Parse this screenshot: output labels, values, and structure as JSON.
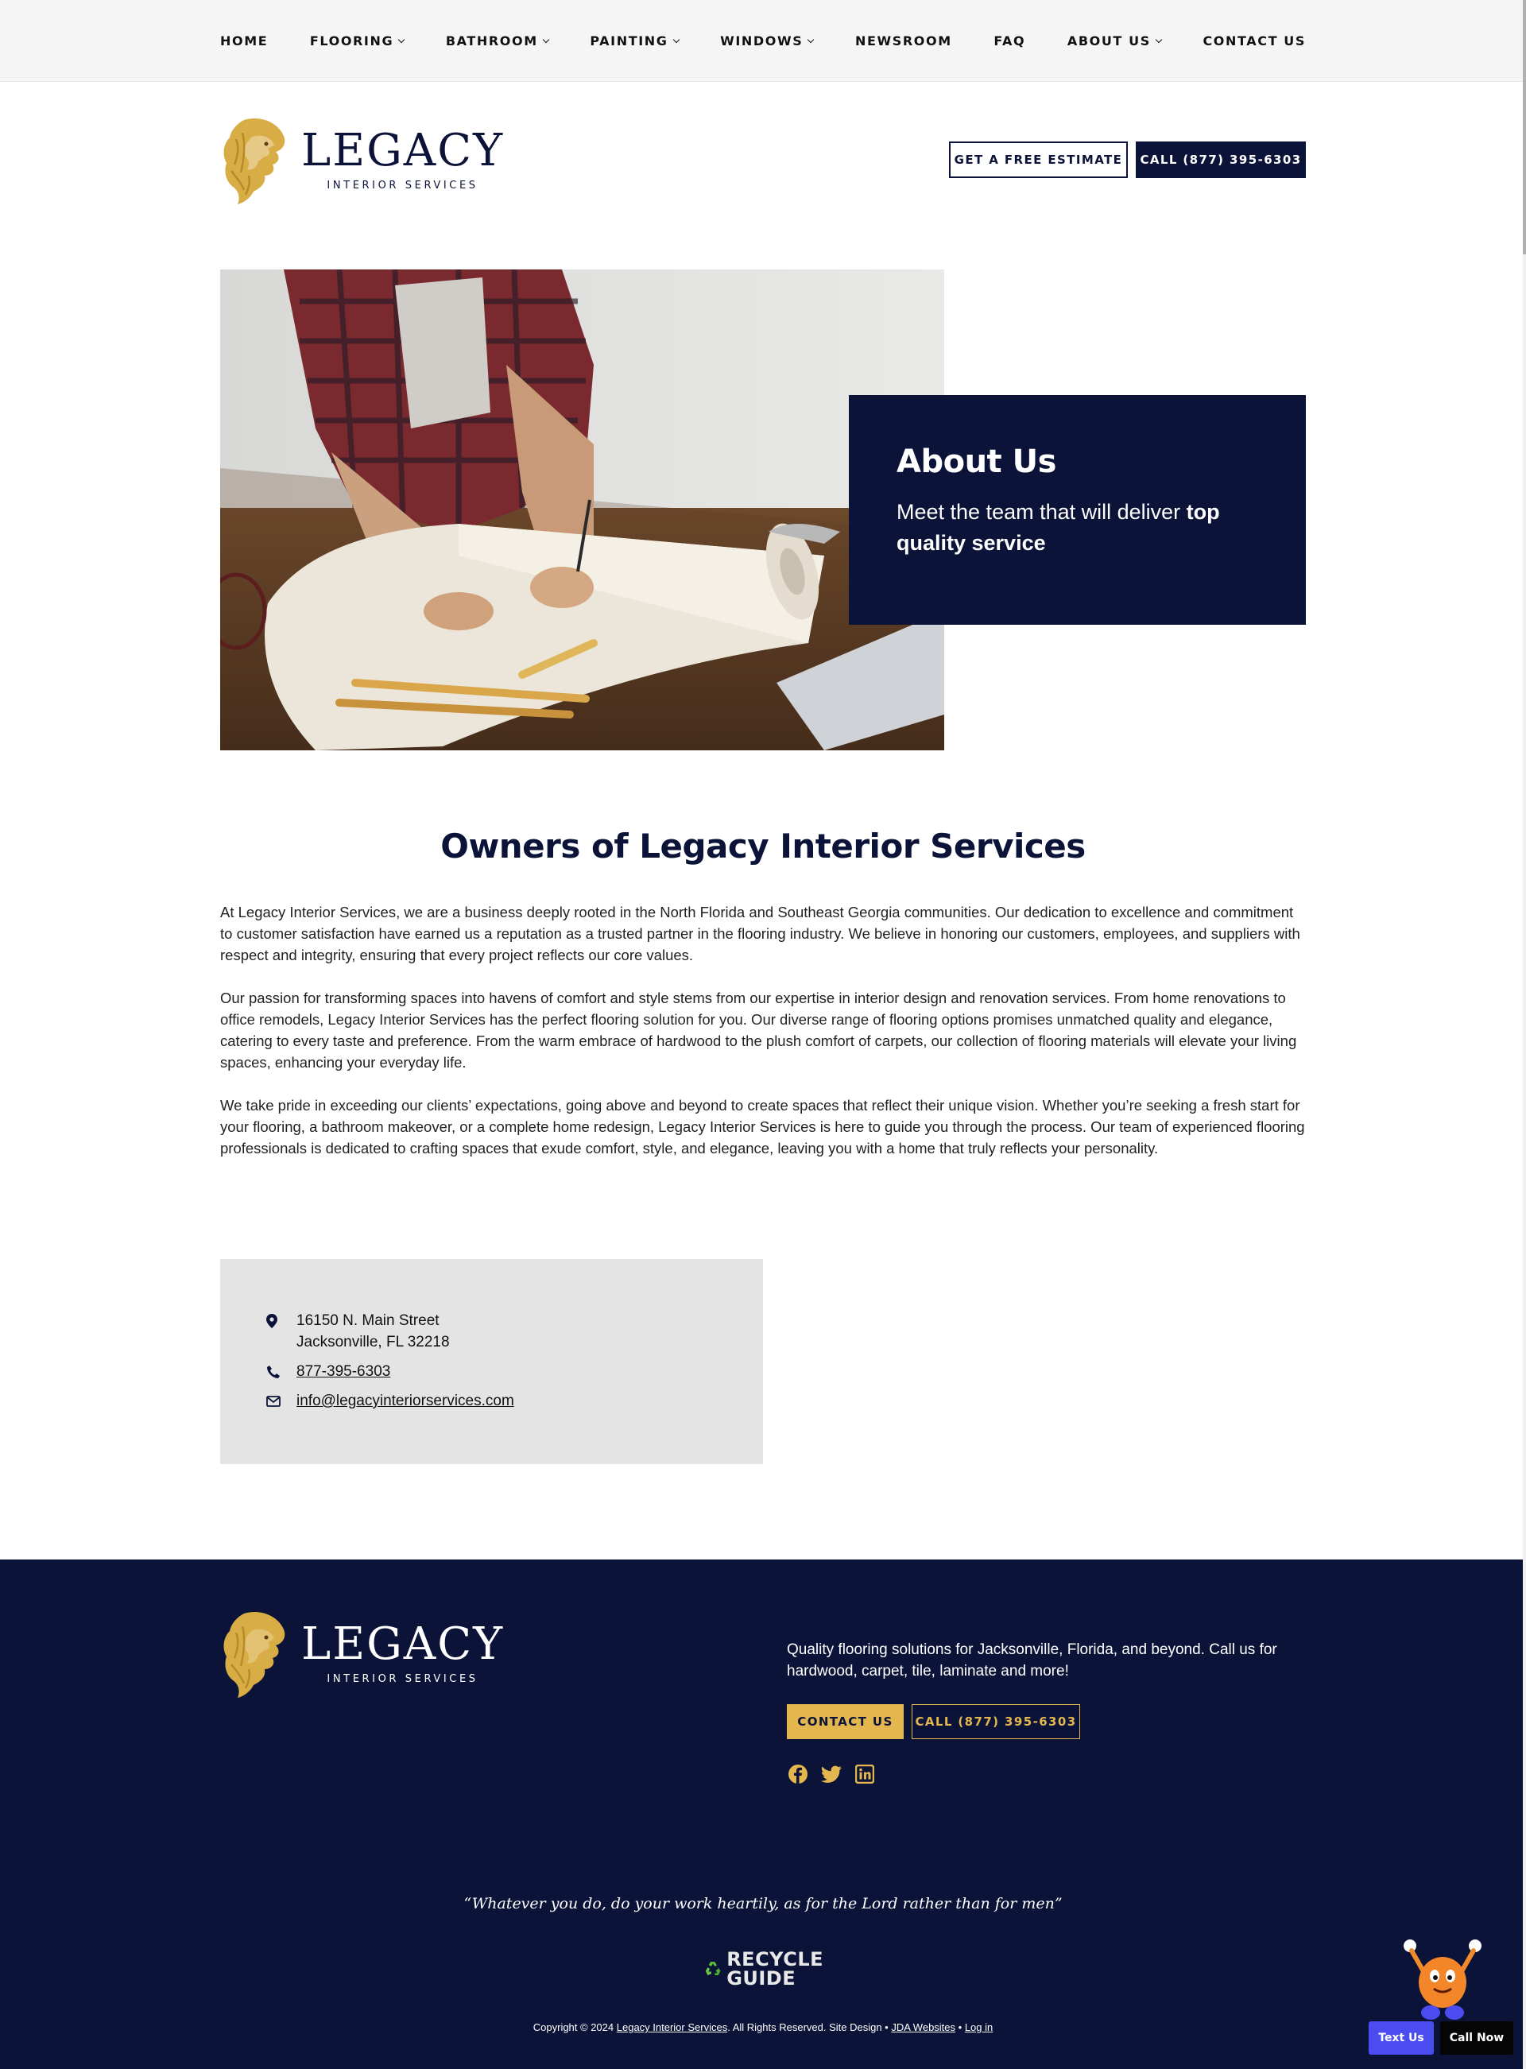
{
  "nav": {
    "items": [
      {
        "label": "HOME",
        "dropdown": false
      },
      {
        "label": "FLOORING",
        "dropdown": true
      },
      {
        "label": "BATHROOM",
        "dropdown": true
      },
      {
        "label": "PAINTING",
        "dropdown": true
      },
      {
        "label": "WINDOWS",
        "dropdown": true
      },
      {
        "label": "NEWSROOM",
        "dropdown": false
      },
      {
        "label": "FAQ",
        "dropdown": false
      },
      {
        "label": "ABOUT US",
        "dropdown": true
      },
      {
        "label": "CONTACT US",
        "dropdown": false
      }
    ]
  },
  "brand": {
    "name": "LEGACY",
    "tagline": "INTERIOR SERVICES",
    "gold": "#d9ad45",
    "navy": "#0c1338"
  },
  "header": {
    "estimate_label": "GET A FREE ESTIMATE",
    "call_label": "CALL (877) 395-6303"
  },
  "hero": {
    "title": "About Us",
    "subtitle_prefix": "Meet the team that will deliver ",
    "subtitle_bold": "top quality service"
  },
  "main": {
    "title": "Owners of Legacy Interior Services",
    "paragraphs": [
      "At Legacy Interior Services, we are a business deeply rooted in the North Florida and Southeast Georgia communities. Our dedication to excellence and commitment to customer satisfaction have earned us a reputation as a trusted partner in the flooring industry. We believe in honoring our customers, employees, and suppliers with respect and integrity, ensuring that every project reflects our core values.",
      "Our passion for transforming spaces into havens of comfort and style stems from our expertise in interior design and renovation services. From home renovations to office remodels, Legacy Interior Services has the perfect flooring solution for you. Our diverse range of flooring options promises unmatched quality and elegance, catering to every taste and preference. From the warm embrace of hardwood to the plush comfort of carpets, our collection of flooring materials will elevate your living spaces, enhancing your everyday life.",
      "We take pride in exceeding our clients’ expectations, going above and beyond to create spaces that reflect their unique vision. Whether you’re seeking a fresh start for your flooring, a bathroom makeover, or a complete home redesign, Legacy Interior Services is here to guide you through the process. Our team of experienced flooring professionals is dedicated to crafting spaces that exude comfort, style, and elegance, leaving you with a home that truly reflects your personality."
    ]
  },
  "contact": {
    "address_line1": "16150 N. Main Street",
    "address_line2": "Jacksonville, FL 32218",
    "phone": "877-395-6303",
    "email": "info@legacyinteriorservices.com"
  },
  "footer": {
    "tagline": "Quality flooring solutions for Jacksonville, Florida, and beyond. Call us for hardwood, carpet, tile, laminate and more!",
    "contact_label": "CONTACT US",
    "call_label": "CALL (877) 395-6303",
    "socials": [
      "facebook-icon",
      "twitter-icon",
      "linkedin-icon"
    ],
    "quote": "“Whatever you do, do your work heartily, as for the Lord rather than for men”",
    "recycle_line1": "RECYCLE",
    "recycle_line2": "GUIDE",
    "copyright_prefix": "Copyright © 2024 ",
    "copyright_company": "Legacy Interior Services",
    "copyright_middle": ". All Rights Reserved. Site Design • ",
    "copyright_design": "JDA Websites",
    "copyright_sep": " • ",
    "copyright_login": "Log in"
  },
  "floating": {
    "text_label": "Text Us",
    "call_label": "Call Now"
  }
}
